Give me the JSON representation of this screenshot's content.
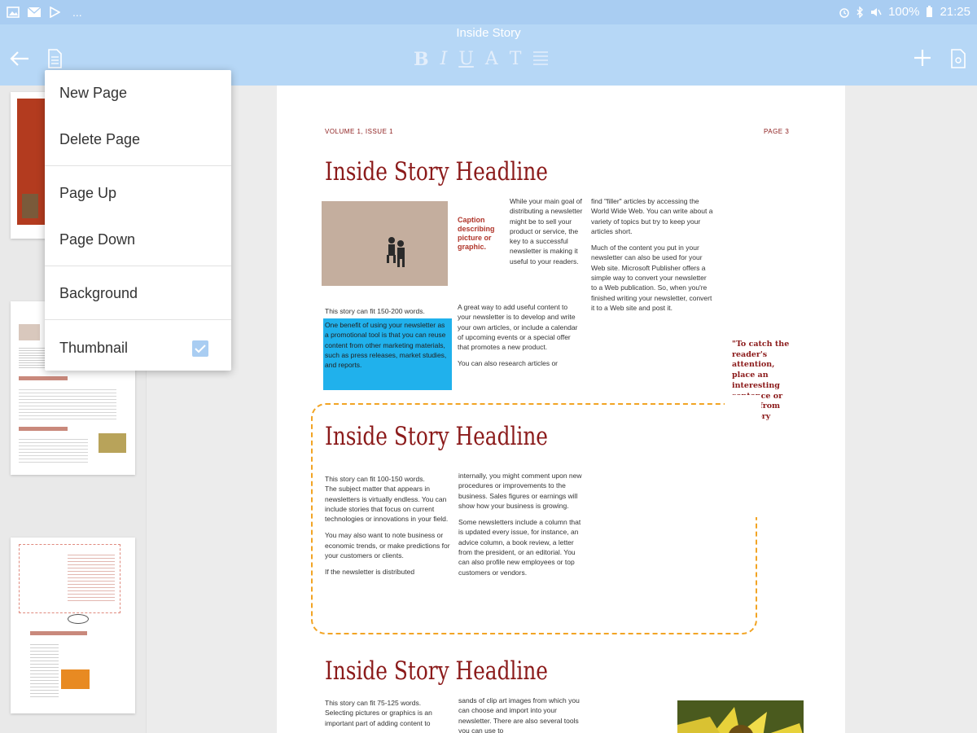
{
  "status_bar": {
    "left_icons": [
      "image-icon",
      "mail-icon",
      "play-store-icon",
      "more-icon"
    ],
    "more_text": "...",
    "battery": "100%",
    "time": "21:25"
  },
  "toolbar": {
    "title": "Inside Story",
    "format_buttons": [
      "B",
      "I",
      "U",
      "A",
      "T"
    ]
  },
  "menu": {
    "items": [
      {
        "label": "New Page"
      },
      {
        "label": "Delete Page"
      },
      {
        "label": "Page Up"
      },
      {
        "label": "Page Down"
      },
      {
        "label": "Background"
      },
      {
        "label": "Thumbnail",
        "checked": true
      }
    ]
  },
  "sidebar": {
    "current_page": "3"
  },
  "document": {
    "volume": "VOLUME 1, ISSUE 1",
    "page": "PAGE 3",
    "headline1": "Inside Story Headline",
    "headline2": "Inside Story Headline",
    "headline3": "Inside Story Headline",
    "caption": "Caption describing picture or graphic.",
    "col1a_lead": "This story can fit 150-200 words.",
    "col1a_highlight": "One benefit of using your newsletter as a promotional tool is that you can reuse content from other marketing materials, such as press releases, market studies, and reports.",
    "col2a_p1": "While your main goal of distributing a newsletter might be to sell your product or service, the key to a successful newsletter is making it useful to your readers.",
    "col2a_p2": "A great way to add useful content to your newsletter is to develop and write your own articles, or include a calendar of upcoming events or a special offer that promotes a new product.",
    "col2a_p3": "You can also research articles or",
    "col3a_p1": "find \"filler\" articles by accessing the World Wide Web. You can write about a variety of topics but try to keep your articles short.",
    "col3a_p2": "Much of the content you put in your newsletter can also be used for your Web site. Microsoft Publisher offers a simple way to convert your newsletter to a Web publication. So, when you're finished writing your newsletter, convert it to a Web site and post it.",
    "quote": "\"To catch the reader's attention, place an interesting sentence or quote from the story here.\"",
    "col1b_p1": "This story can fit 100-150 words.",
    "col1b_p2": "The subject matter that appears in newsletters is virtually endless. You can include stories that focus on current technologies or innovations in your field.",
    "col1b_p3": "You may also want to note business or economic trends, or make predictions for your customers or clients.",
    "col1b_p4": "If the newsletter is distributed",
    "col2b_p1": "internally, you might comment upon new procedures or improvements to the business. Sales figures or earnings will show how your business is growing.",
    "col2b_p2": "Some newsletters include a column that is updated every issue, for instance, an advice column, a book review, a letter from the president, or an editorial. You can also profile new employees or top customers or vendors.",
    "col1c_p1": "This story can fit 75-125 words.",
    "col1c_p2": "Selecting pictures or graphics is an important part of adding content to",
    "col2c_p1": "sands of clip art images from which you can choose and import into your newsletter. There are also several tools you can use to"
  }
}
